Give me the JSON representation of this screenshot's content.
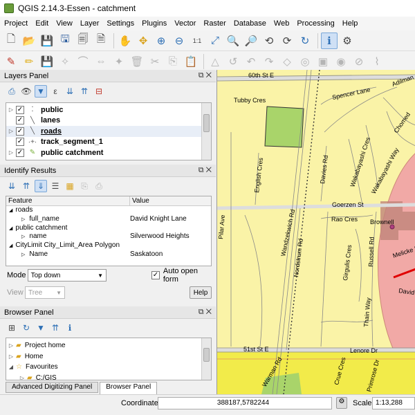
{
  "window": {
    "title": "QGIS 2.14.3-Essen - catchment"
  },
  "menu": [
    "Project",
    "Edit",
    "View",
    "Layer",
    "Settings",
    "Plugins",
    "Vector",
    "Raster",
    "Database",
    "Web",
    "Processing",
    "Help"
  ],
  "layers_panel": {
    "title": "Layers Panel",
    "layers": [
      {
        "name": "public",
        "checked": true,
        "symbol": "point-dots-icon"
      },
      {
        "name": "lanes",
        "checked": true,
        "symbol": "line-icon"
      },
      {
        "name": "roads",
        "checked": true,
        "symbol": "line-icon"
      },
      {
        "name": "track_segment_1",
        "checked": true,
        "symbol": "point-track-icon"
      },
      {
        "name": "public catchment",
        "checked": true,
        "symbol": "polygon-fill-icon"
      }
    ]
  },
  "identify_results": {
    "title": "Identify Results",
    "columns": {
      "feature": "Feature",
      "value": "Value"
    },
    "groups": [
      {
        "label": "roads",
        "attr": "full_name",
        "value": "David Knight Lane"
      },
      {
        "label": "public catchment",
        "attr": "name",
        "value": "Silverwood Heights"
      },
      {
        "label": "CityLimit City_Limit_Area Polygon",
        "attr": "Name",
        "value": "Saskatoon"
      }
    ],
    "mode_label": "Mode",
    "mode_value": "Top down",
    "auto_open_label": "Auto open form",
    "auto_open_checked": true,
    "view_label": "View",
    "view_value": "Tree",
    "help_label": "Help"
  },
  "browser_panel": {
    "title": "Browser Panel",
    "items": [
      {
        "label": "Project home",
        "indent": 0,
        "icon": "folder-icon"
      },
      {
        "label": "Home",
        "indent": 0,
        "icon": "folder-icon"
      },
      {
        "label": "Favourites",
        "indent": 0,
        "icon": "star-icon"
      },
      {
        "label": "C:/GIS",
        "indent": 1,
        "icon": "folder-icon"
      }
    ]
  },
  "tabs": [
    "Advanced Digitizing Panel",
    "Browser Panel"
  ],
  "status": {
    "coordinate_label": "Coordinate",
    "coordinate_value": "388187,5782244",
    "scale_label": "Scale",
    "scale_value": "1:13,288"
  },
  "map": {
    "labels": [
      "60th St E",
      "Tubby Cres",
      "Spencer Lane",
      "Adilman",
      "Chomed",
      "English Cres",
      "Davies Rd",
      "Wakabayashi Cres",
      "Wakabayashi Way",
      "Goerzen St",
      "Rao Cres",
      "Brownell",
      "Pilar Ave",
      "Wandzekwich Rd",
      "Nordstrum Rd",
      "Girgulis Cres",
      "Russell Rd",
      "Melicke Pl",
      "David",
      "Thain Way",
      "51st St E",
      "Lenore Dr",
      "Warman Rd",
      "Crue Cres",
      "Primrose Dr"
    ],
    "colors": {
      "land": "#faf3a7",
      "catchment": "#f1a9a6",
      "park": "#a9d46a",
      "roads": "#ffffff",
      "highlight": "#e00000"
    }
  }
}
